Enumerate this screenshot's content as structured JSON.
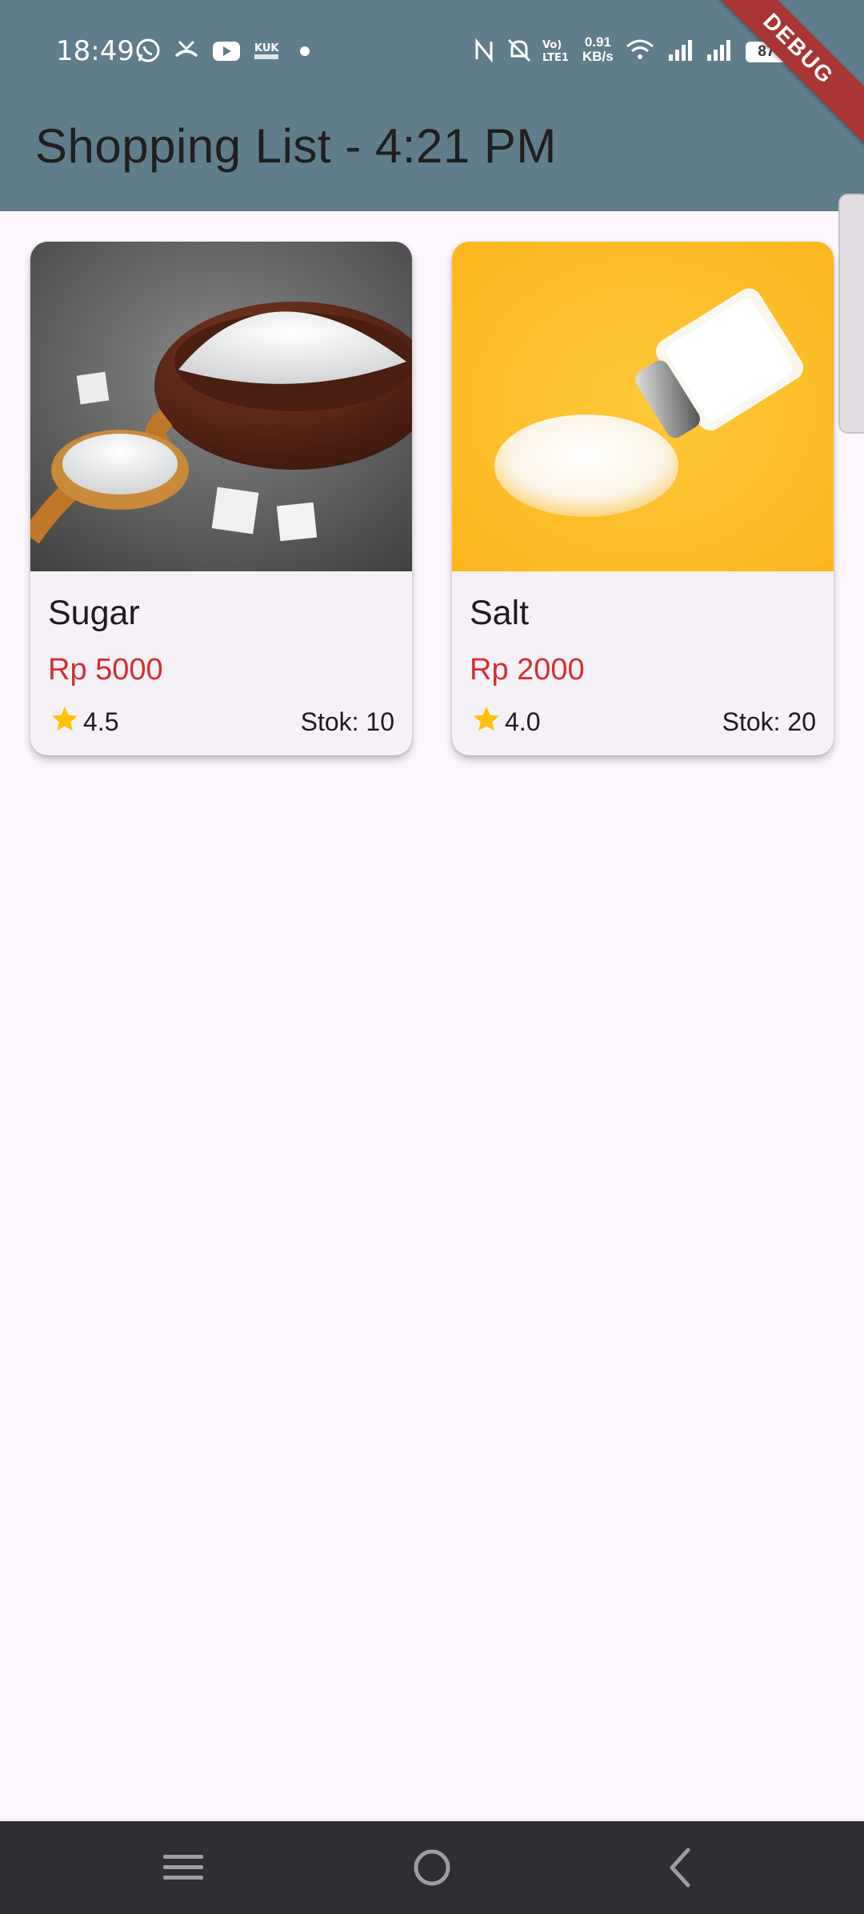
{
  "status_bar": {
    "time": "18:49",
    "speed_value": "0.91",
    "speed_unit": "KB/s",
    "battery": "87",
    "icons": [
      "whatsapp-icon",
      "missed-call-icon",
      "youtube-icon",
      "kuk-app-icon",
      "notification-dot-icon",
      "nfc-icon",
      "bell-off-icon",
      "volte-lte-icon",
      "wifi-icon",
      "signal-icon",
      "signal-icon",
      "battery-icon",
      "charging-icon"
    ]
  },
  "app_bar": {
    "title": "Shopping List - 4:21 PM",
    "color": "#607d8b"
  },
  "debug_banner": "DEBUG",
  "products": [
    {
      "name": "Sugar",
      "price": "Rp 5000",
      "rating": "4.5",
      "stock": "Stok: 10",
      "image": "sugar-bowl-photo"
    },
    {
      "name": "Salt",
      "price": "Rp 2000",
      "rating": "4.0",
      "stock": "Stok: 20",
      "image": "salt-shaker-photo"
    }
  ],
  "colors": {
    "price": "#d32f2f",
    "star": "#ffc107",
    "background": "#fdf7fd",
    "card": "#f5f1f7"
  },
  "nav_bar": {
    "buttons": [
      "menu-icon",
      "home-icon",
      "back-icon"
    ]
  }
}
